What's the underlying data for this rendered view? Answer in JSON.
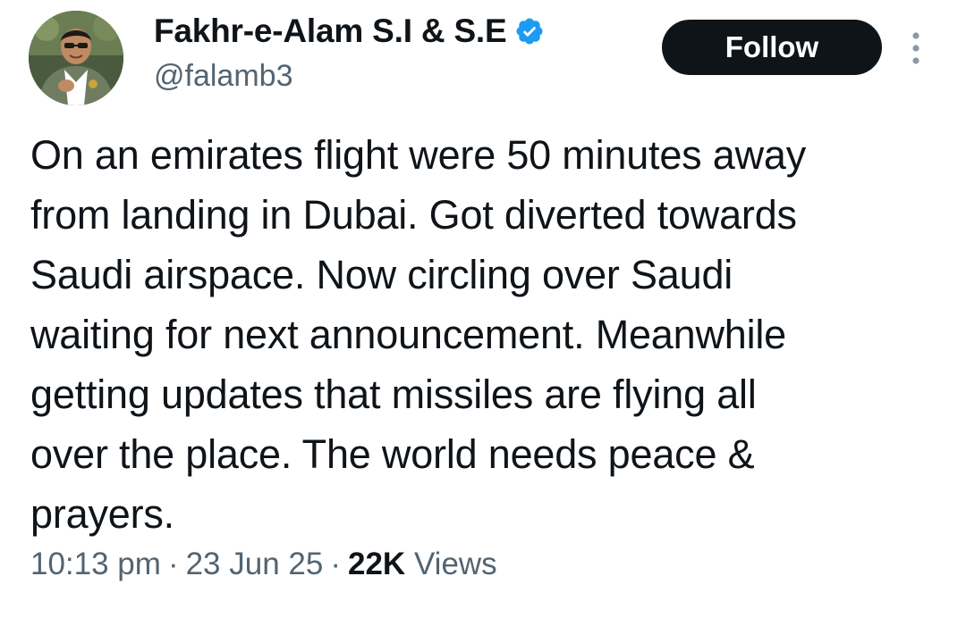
{
  "user": {
    "display_name": "Fakhr-e-Alam S.I & S.E",
    "handle": "@falamb3",
    "verified": true,
    "avatar": "profile-photo"
  },
  "follow_button": {
    "label": "Follow"
  },
  "more_menu": {
    "icon": "vertical-ellipsis-icon"
  },
  "tweet": {
    "lines": [
      "On an emirates flight were 50 minutes away",
      "from landing in Dubai. Got diverted towards",
      "Saudi airspace. Now circling over Saudi",
      "waiting for next announcement. Meanwhile",
      "getting updates that missiles are flying all",
      "over the place. The world needs peace &",
      "prayers."
    ]
  },
  "meta": {
    "time": "10:13 pm",
    "separator": "·",
    "date": "23 Jun 25",
    "views_count": "22K",
    "views_label": "Views"
  },
  "colors": {
    "text": "#0f1419",
    "secondary": "#536471",
    "verified_badge": "#1d9bf0",
    "follow_bg": "#0f1419"
  }
}
